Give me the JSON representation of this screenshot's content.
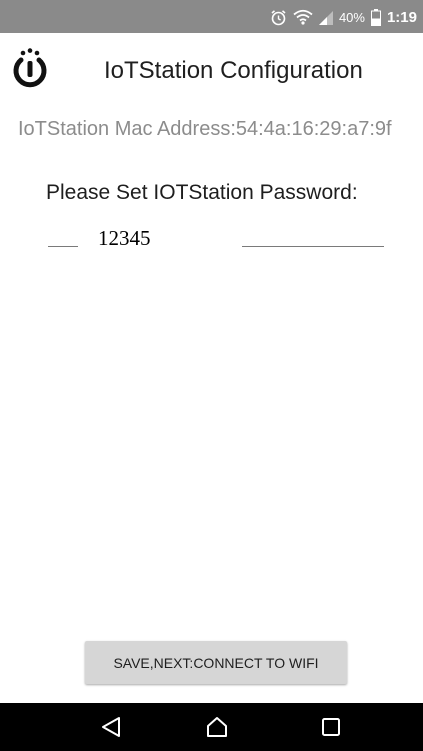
{
  "status_bar": {
    "alarm_icon": "alarm-clock-icon",
    "wifi_icon": "wifi-icon",
    "signal_icon": "cell-signal-icon",
    "battery_percent": "40%",
    "battery_level": 0.4,
    "battery_icon": "battery-icon",
    "time": "1:19"
  },
  "header": {
    "logo_icon": "iotstation-logo-icon",
    "title": "IoTStation Configuration"
  },
  "main": {
    "mac_address_text": "IoTStation Mac Address:54:4a:16:29:a7:9f",
    "password_prompt": "Please Set IOTStation Password:",
    "password_value": "12345",
    "save_button_label": "SAVE,NEXT:CONNECT TO WIFI"
  },
  "nav_bar": {
    "back_icon": "back-triangle-icon",
    "home_icon": "home-icon",
    "recent_icon": "recent-apps-icon"
  },
  "colors": {
    "status_bar_bg": "#8a8a8a",
    "text_primary": "#1f1f1f",
    "text_secondary": "#8c8c8c",
    "button_bg": "#d6d6d6",
    "nav_bar_bg": "#000000"
  }
}
